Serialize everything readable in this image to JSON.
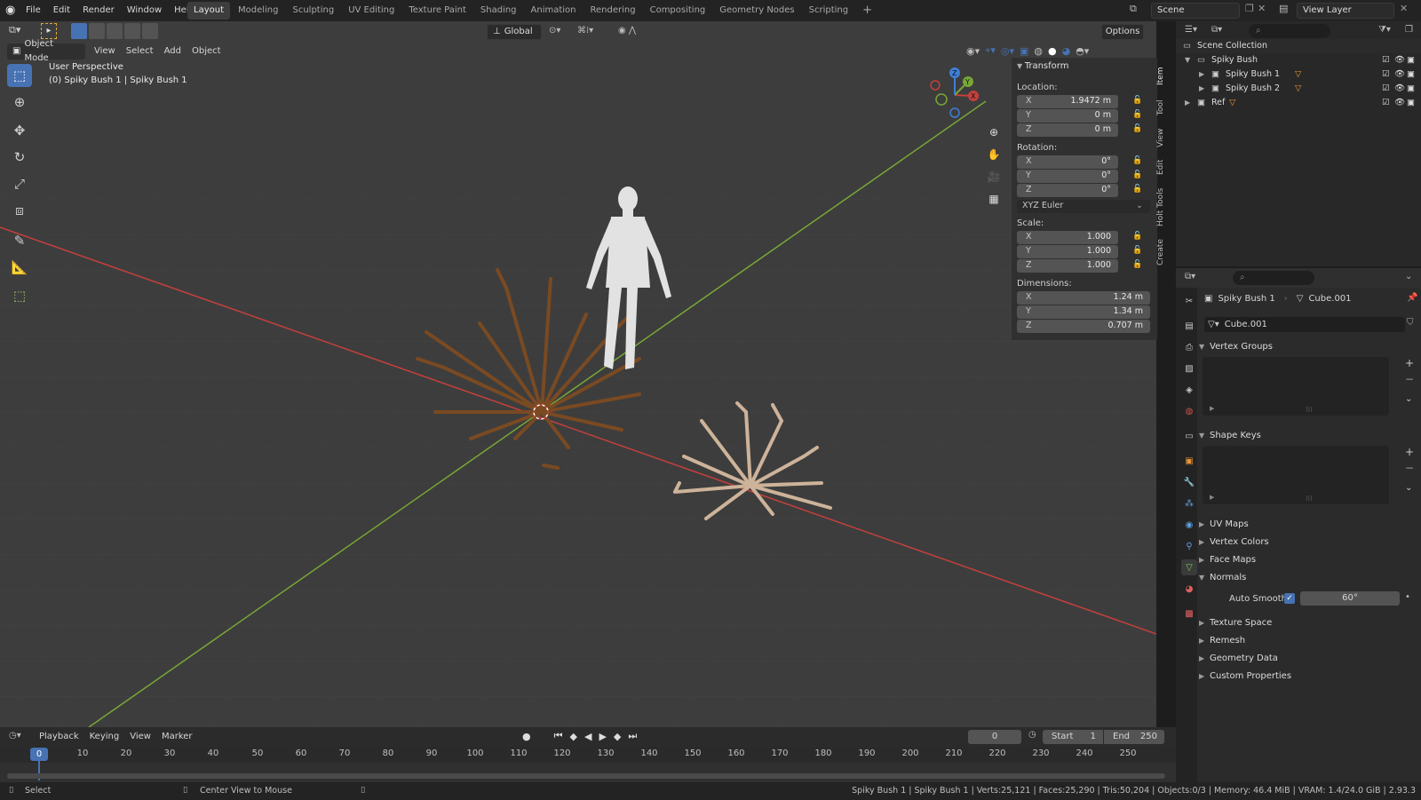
{
  "menubar": {
    "items": [
      "File",
      "Edit",
      "Render",
      "Window",
      "Help"
    ]
  },
  "workspaces": {
    "tabs": [
      "Layout",
      "Modeling",
      "Sculpting",
      "UV Editing",
      "Texture Paint",
      "Shading",
      "Animation",
      "Rendering",
      "Compositing",
      "Geometry Nodes",
      "Scripting"
    ],
    "active": "Layout",
    "add": "+"
  },
  "scene": {
    "name": "Scene",
    "view_layer": "View Layer"
  },
  "viewport": {
    "mode": "Object Mode",
    "menus": [
      "View",
      "Select",
      "Add",
      "Object"
    ],
    "orientation": "Global",
    "options": "Options",
    "overlay_title": "User Perspective",
    "overlay_subtitle": "(0) Spiky Bush 1 | Spiky Bush 1",
    "gizmo": {
      "x": "X",
      "y": "Y",
      "z": "Z"
    }
  },
  "npanel": {
    "header": "Transform",
    "location_label": "Location:",
    "location": {
      "x": "1.9472 m",
      "y": "0 m",
      "z": "0 m"
    },
    "rotation_label": "Rotation:",
    "rotation": {
      "x": "0°",
      "y": "0°",
      "z": "0°"
    },
    "rotation_mode": "XYZ Euler",
    "scale_label": "Scale:",
    "scale": {
      "x": "1.000",
      "y": "1.000",
      "z": "1.000"
    },
    "dimensions_label": "Dimensions:",
    "dimensions": {
      "x": "1.24 m",
      "y": "1.34 m",
      "z": "0.707 m"
    },
    "axes": {
      "x": "X",
      "y": "Y",
      "z": "Z"
    },
    "tabs": [
      "Item",
      "Tool",
      "View",
      "Edit",
      "Holt Tools",
      "Create"
    ]
  },
  "outliner": {
    "rows": [
      {
        "label": "Scene Collection"
      },
      {
        "label": "Spiky Bush"
      },
      {
        "label": "Spiky Bush 1"
      },
      {
        "label": "Spiky Bush 2"
      },
      {
        "label": "Ref"
      }
    ]
  },
  "properties": {
    "object_name": "Spiky Bush 1",
    "mesh_name": "Cube.001",
    "datablock": "Cube.001",
    "sections": [
      {
        "label": "Vertex Groups",
        "open": true
      },
      {
        "label": "Shape Keys",
        "open": true
      },
      {
        "label": "UV Maps",
        "open": false
      },
      {
        "label": "Vertex Colors",
        "open": false
      },
      {
        "label": "Face Maps",
        "open": false
      },
      {
        "label": "Normals",
        "open": true
      },
      {
        "label": "Texture Space",
        "open": false
      },
      {
        "label": "Remesh",
        "open": false
      },
      {
        "label": "Geometry Data",
        "open": false
      },
      {
        "label": "Custom Properties",
        "open": false
      }
    ],
    "auto_smooth_label": "Auto Smooth",
    "auto_smooth_angle": "60°"
  },
  "timeline": {
    "menus": [
      "Playback",
      "Keying",
      "View",
      "Marker"
    ],
    "current_frame": "0",
    "start_label": "Start",
    "start": "1",
    "end_label": "End",
    "end": "250",
    "ticks": [
      "0",
      "10",
      "20",
      "30",
      "40",
      "50",
      "60",
      "70",
      "80",
      "90",
      "100",
      "110",
      "120",
      "130",
      "140",
      "150",
      "160",
      "170",
      "180",
      "190",
      "200",
      "210",
      "220",
      "230",
      "240",
      "250"
    ],
    "playhead": "0"
  },
  "statusbar": {
    "select": "Select",
    "center": "Center View to Mouse",
    "stats": "Spiky Bush 1 | Spiky Bush 1 | Verts:25,121 | Faces:25,290 | Tris:50,204 | Objects:0/3 | Memory: 46.4 MiB | VRAM: 1.4/24.0 GiB | 2.93.3"
  },
  "colors": {
    "accent": "#4772b3",
    "x_axis": "#c4403c",
    "y_axis": "#78a736",
    "z_axis": "#3f7fd6",
    "bush_dark": "#7a4a22",
    "bush_light": "#cdb39a"
  }
}
